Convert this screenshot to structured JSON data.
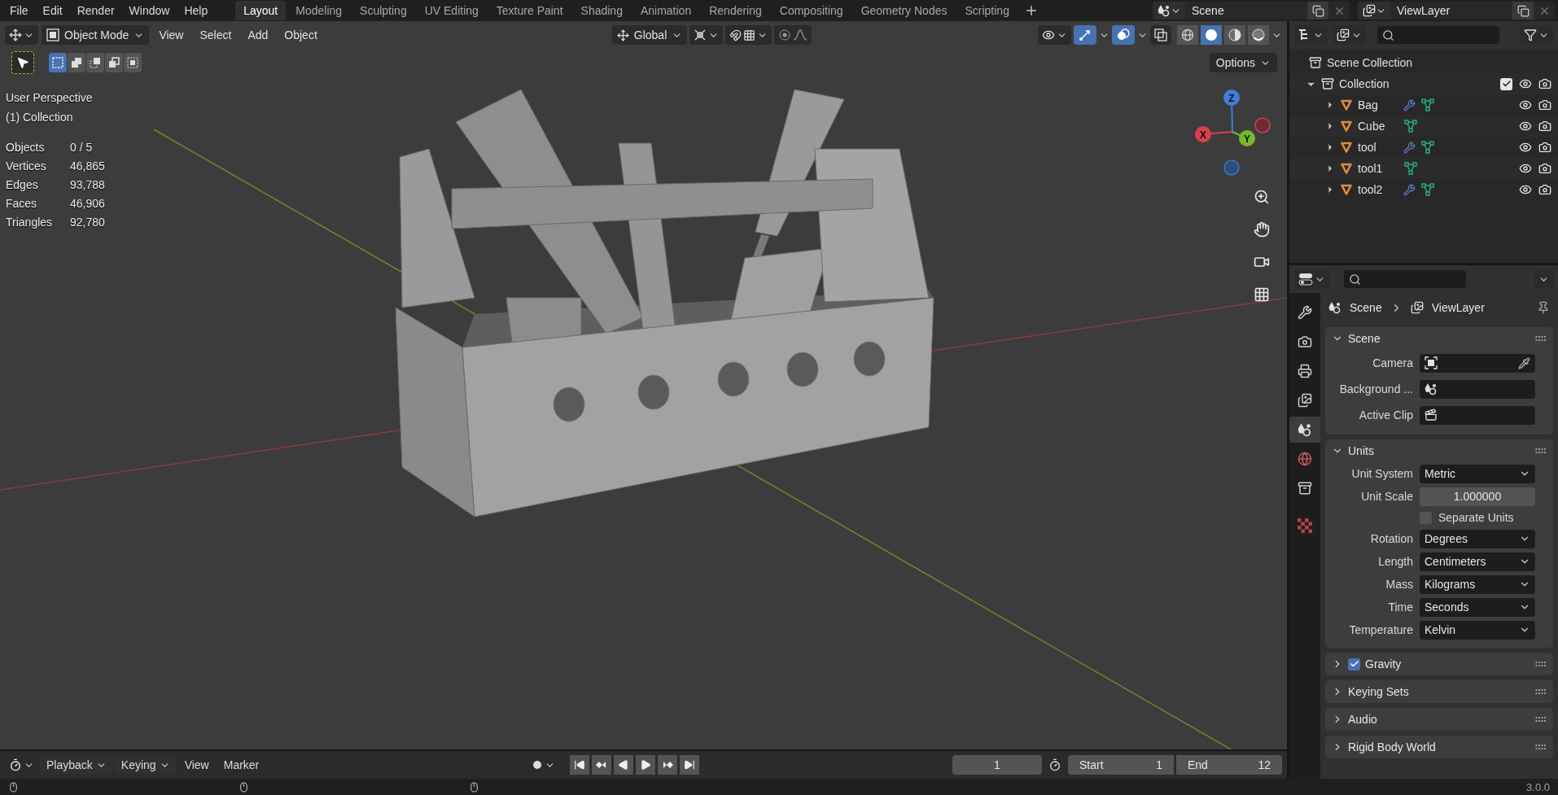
{
  "menu": [
    "File",
    "Edit",
    "Render",
    "Window",
    "Help"
  ],
  "workspaces": [
    {
      "label": "Layout",
      "selected": true
    },
    {
      "label": "Modeling",
      "selected": false
    },
    {
      "label": "Sculpting",
      "selected": false
    },
    {
      "label": "UV Editing",
      "selected": false
    },
    {
      "label": "Texture Paint",
      "selected": false
    },
    {
      "label": "Shading",
      "selected": false
    },
    {
      "label": "Animation",
      "selected": false
    },
    {
      "label": "Rendering",
      "selected": false
    },
    {
      "label": "Compositing",
      "selected": false
    },
    {
      "label": "Geometry Nodes",
      "selected": false
    },
    {
      "label": "Scripting",
      "selected": false
    }
  ],
  "scene": "Scene",
  "view_layer": "ViewLayer",
  "viewport": {
    "mode": "Object Mode",
    "menus": [
      "View",
      "Select",
      "Add",
      "Object"
    ],
    "orientation": "Global",
    "gizmos_on": true,
    "overlays_on": true,
    "shading": [
      {
        "kind": "wireframe",
        "selected": false
      },
      {
        "kind": "solid",
        "selected": true
      },
      {
        "kind": "material",
        "selected": false
      },
      {
        "kind": "rendered",
        "selected": false
      }
    ],
    "select_modes": [
      {
        "selected": true
      },
      {
        "selected": false
      },
      {
        "selected": false
      },
      {
        "selected": false
      },
      {
        "selected": false
      }
    ],
    "options": "Options",
    "info": [
      "User Perspective",
      "(1) Collection"
    ],
    "stats": [
      {
        "label": "Objects",
        "value": "0 / 5"
      },
      {
        "label": "Vertices",
        "value": "46,865"
      },
      {
        "label": "Edges",
        "value": "93,788"
      },
      {
        "label": "Faces",
        "value": "46,906"
      },
      {
        "label": "Triangles",
        "value": "92,780"
      }
    ],
    "gizmo": [
      "Z",
      "X",
      "Y"
    ]
  },
  "outliner": {
    "root": "Scene Collection",
    "collections": [
      {
        "name": "Collection",
        "expanded": true,
        "checked": true,
        "children": [
          {
            "name": "Bag",
            "expanded": false,
            "modifier": true
          },
          {
            "name": "Cube",
            "expanded": false,
            "modifier": false
          },
          {
            "name": "tool",
            "expanded": false,
            "modifier": true
          },
          {
            "name": "tool1",
            "expanded": false,
            "modifier": false
          },
          {
            "name": "tool2",
            "expanded": false,
            "modifier": true
          }
        ]
      }
    ]
  },
  "properties": {
    "tabs": [
      {
        "kind": "tool",
        "selected": false
      },
      {
        "kind": "render",
        "selected": false
      },
      {
        "kind": "output",
        "selected": false
      },
      {
        "kind": "view_layer",
        "selected": false
      },
      {
        "kind": "scene",
        "selected": true
      },
      {
        "kind": "world",
        "selected": false
      },
      {
        "kind": "collection",
        "selected": false
      },
      {
        "kind": "texture",
        "selected": false
      }
    ],
    "breadcrumb": [
      "Scene",
      "ViewLayer"
    ],
    "panels": [
      {
        "title": "Scene",
        "expanded": true,
        "fields": [
          {
            "kind": "object",
            "label": "Camera"
          },
          {
            "kind": "world",
            "label": "Background ..."
          },
          {
            "kind": "clip",
            "label": "Active Clip"
          }
        ]
      },
      {
        "title": "Units",
        "expanded": true,
        "fields": [
          {
            "kind": "select",
            "label": "Unit System",
            "value": "Metric"
          },
          {
            "kind": "number",
            "label": "Unit Scale",
            "value": "1.000000"
          },
          {
            "kind": "checkbox",
            "label": "Separate Units",
            "checked": false
          },
          {
            "kind": "select",
            "label": "Rotation",
            "value": "Degrees"
          },
          {
            "kind": "select",
            "label": "Length",
            "value": "Centimeters"
          },
          {
            "kind": "select",
            "label": "Mass",
            "value": "Kilograms"
          },
          {
            "kind": "select",
            "label": "Time",
            "value": "Seconds"
          },
          {
            "kind": "select",
            "label": "Temperature",
            "value": "Kelvin"
          }
        ]
      },
      {
        "title": "Gravity",
        "expanded": false,
        "toggle": {
          "checked": true
        }
      },
      {
        "title": "Keying Sets",
        "expanded": false
      },
      {
        "title": "Audio",
        "expanded": false
      },
      {
        "title": "Rigid Body World",
        "expanded": false
      }
    ]
  },
  "timeline": {
    "menus": [
      {
        "label": "Playback",
        "dropdown": true
      },
      {
        "label": "Keying",
        "dropdown": true
      },
      {
        "label": "View",
        "dropdown": false
      },
      {
        "label": "Marker",
        "dropdown": false
      }
    ],
    "frame": "1",
    "start_label": "Start",
    "start": "1",
    "end_label": "End",
    "end": "12"
  },
  "status_bar": {
    "version": "3.0.0"
  }
}
